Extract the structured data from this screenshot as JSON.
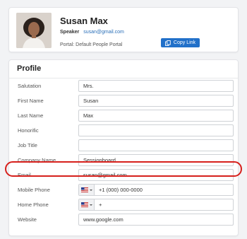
{
  "header": {
    "name": "Susan Max",
    "role": "Speaker",
    "email": "susan@gmail.com",
    "portal": "Portal: Default People Portal",
    "copy_label": "Copy Link"
  },
  "profile": {
    "title": "Profile",
    "fields": {
      "salutation": {
        "label": "Salutation",
        "value": "Mrs."
      },
      "first_name": {
        "label": "First Name",
        "value": "Susan"
      },
      "last_name": {
        "label": "Last Name",
        "value": "Max"
      },
      "honorific": {
        "label": "Honorific",
        "value": ""
      },
      "job_title": {
        "label": "Job Title",
        "value": ""
      },
      "company_name": {
        "label": "Company Name",
        "value": "Sessionboard"
      },
      "email": {
        "label": "Email",
        "value": "susan@gmail.com"
      },
      "mobile_phone": {
        "label": "Mobile Phone",
        "value": "+1 (000) 000-0000",
        "country": "US"
      },
      "home_phone": {
        "label": "Home Phone",
        "value": "+",
        "country": "US"
      },
      "website": {
        "label": "Website",
        "value": "www.google.com"
      }
    }
  },
  "colors": {
    "accent": "#2170c9",
    "highlight": "#d6201c"
  },
  "icons": {
    "copy": "copy-icon",
    "flag": "us-flag-icon",
    "caret": "chevron-down-icon"
  }
}
